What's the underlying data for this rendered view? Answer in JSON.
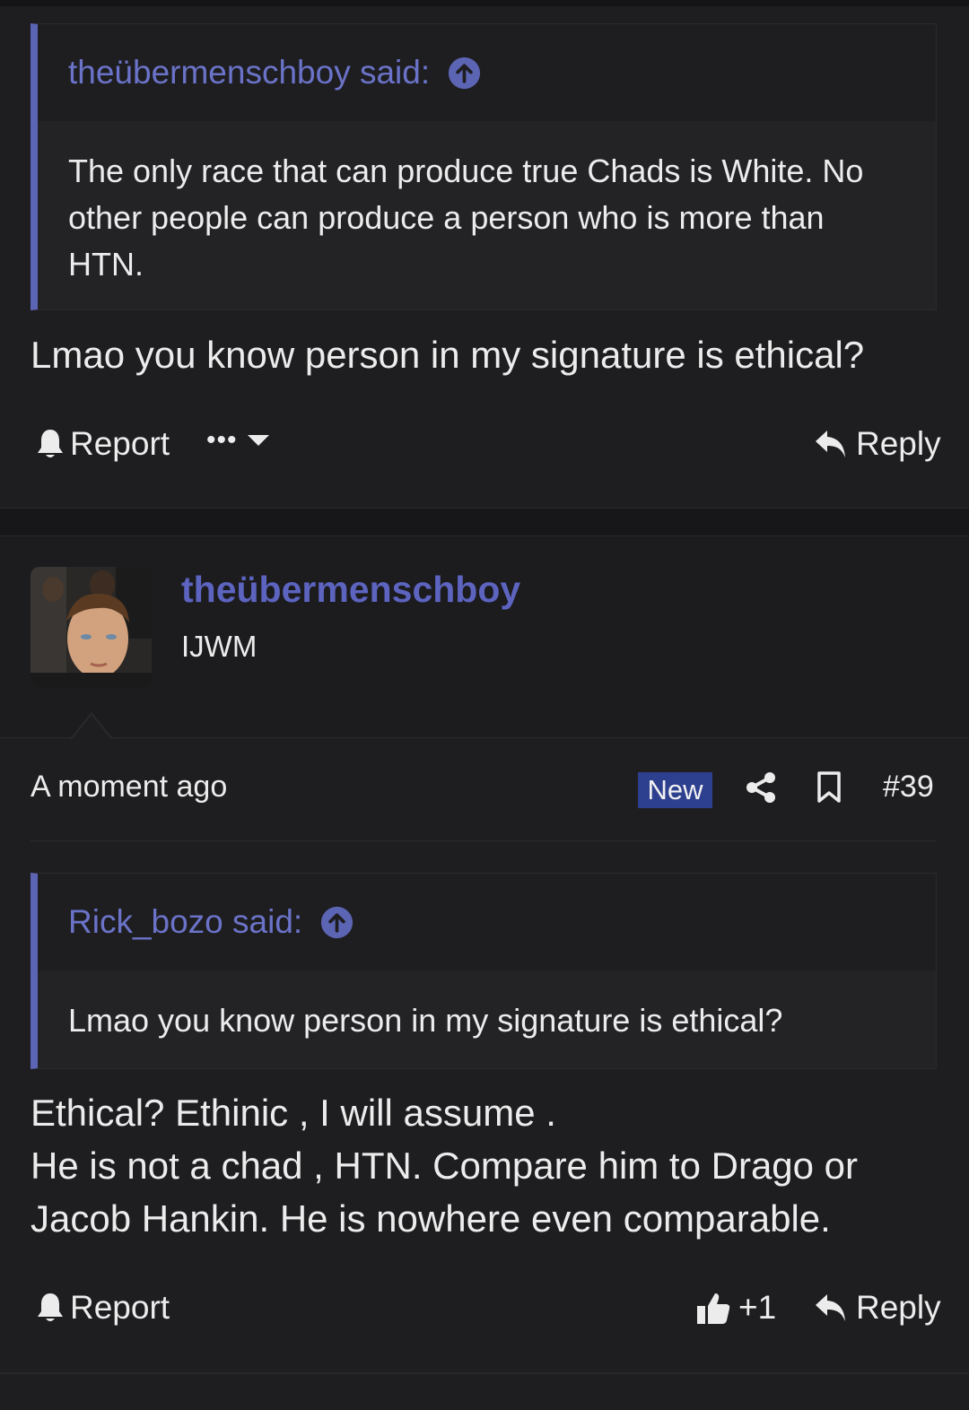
{
  "post1": {
    "quote_author": "theübermenschboy said:",
    "quote_text": "The only race that can produce true Chads is White. No other people can produce a person who is more than HTN.",
    "text": "Lmao you know person in my signature is ethical?",
    "report_label": "Report",
    "more_label": "•••",
    "reply_label": "Reply"
  },
  "post2": {
    "username": "theübermenschboy",
    "user_title": "IJWM",
    "time": "A moment ago",
    "badge": "New",
    "post_number": "#39",
    "quote_author": "Rick_bozo said:",
    "quote_text": "Lmao you know person in my signature is ethical?",
    "text_lines": [
      "Ethical? Ethinic , I will assume .",
      "He is not a chad , HTN. Compare him to Drago or",
      "Jacob Hankin. He is nowhere even comparable."
    ],
    "report_label": "Report",
    "like_count": "+1",
    "reply_label": "Reply"
  },
  "icons": {
    "accent": "#5c64b4",
    "link": "#6b73c8",
    "badge_bg": "#2d3f8f"
  }
}
